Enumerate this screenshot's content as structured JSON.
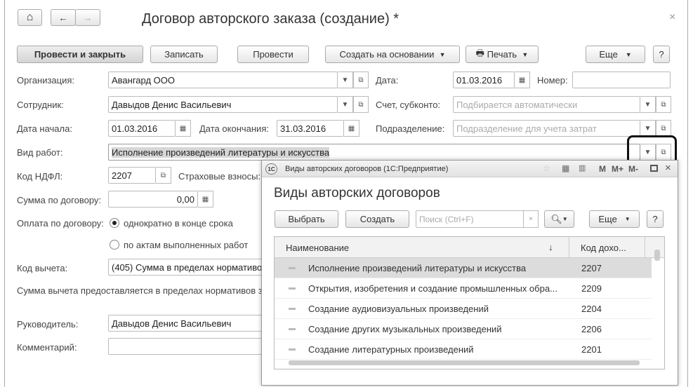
{
  "window": {
    "title": "Договор авторского заказа (создание) *",
    "close": "×"
  },
  "nav": {
    "home": "⌂",
    "back": "←",
    "forward": "→"
  },
  "toolbar": {
    "post_close": "Провести и закрыть",
    "save": "Записать",
    "post": "Провести",
    "create_based": "Создать на основании",
    "print": "Печать",
    "more": "Еще",
    "help": "?"
  },
  "form": {
    "org_label": "Организация:",
    "org": "Авангард ООО",
    "date_label": "Дата:",
    "date": "01.03.2016",
    "number_label": "Номер:",
    "number": "",
    "employee_label": "Сотрудник:",
    "employee": "Давыдов Денис Васильевич",
    "account_label": "Счет, субконто:",
    "account_ph": "Подбирается автоматически",
    "start_label": "Дата начала:",
    "start": "01.03.2016",
    "end_label": "Дата окончания:",
    "end": "31.03.2016",
    "dept_label": "Подразделение:",
    "dept_ph": "Подразделение для учета затрат",
    "work_label": "Вид работ:",
    "work": "Исполнение произведений литературы и искусства",
    "ndfl_label": "Код НДФЛ:",
    "ndfl": "2207",
    "ins_label": "Страховые взносы:",
    "sum_label": "Сумма по договору:",
    "sum": "0,00",
    "pay_label": "Оплата по договору:",
    "pay_opt1": "однократно в конце срока",
    "pay_opt2": "по актам выполненных работ",
    "deduct_label": "Код вычета:",
    "deduct": "(405) Сумма в пределах нормативо",
    "deduct_note": "Сумма вычета предоставляется в пределах нормативов з",
    "head_label": "Руководитель:",
    "head": "Давыдов Денис Васильевич",
    "comment_label": "Комментарий:",
    "comment": ""
  },
  "popup": {
    "window_title": "Виды авторских договоров  (1С:Предприятие)",
    "logo": "1С",
    "title_icons": [
      "M",
      "M+",
      "M-"
    ],
    "heading": "Виды авторских договоров",
    "select": "Выбрать",
    "create": "Создать",
    "search_ph": "Поиск (Ctrl+F)",
    "more": "Еще",
    "help": "?",
    "col_name": "Наименование",
    "sort": "↓",
    "col_code": "Код дохо...",
    "rows": [
      {
        "name": "Исполнение произведений литературы и искусства",
        "code": "2207"
      },
      {
        "name": "Открытия, изобретения и создание промышленных обра...",
        "code": "2209"
      },
      {
        "name": "Создание аудиовизуальных произведений",
        "code": "2204"
      },
      {
        "name": "Создание других музыкальных произведений",
        "code": "2206"
      },
      {
        "name": "Создание литературных произведений",
        "code": "2201"
      }
    ]
  }
}
